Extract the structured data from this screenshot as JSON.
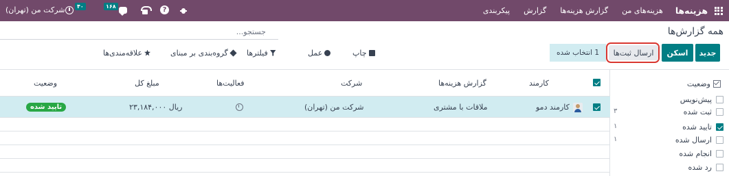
{
  "navbar": {
    "brand": "هزینه‌ها",
    "menu": [
      "هزینه‌های من",
      "گزارش هزینه‌ها",
      "گزارش",
      "پیکربندی"
    ],
    "company": "شرکت من (تهران)",
    "activities_badge": "۴۰",
    "messages_badge": "۱۶۸",
    "help": "?"
  },
  "control_panel": {
    "title": "همه گزارش‌ها",
    "search_placeholder": "جستجو...",
    "new_label": "جدید",
    "scan_label": "اسکن",
    "submit_label": "ارسال ثبت‌ها",
    "selected_label": "1 انتخاب شده",
    "print_label": "چاپ",
    "action_label": "عمل",
    "filters_label": "فیلترها",
    "group_by_label": "گروه‌بندی بر مبنای",
    "favorites_label": "علاقه‌مندی‌ها"
  },
  "list": {
    "columns": {
      "employee": "کارمند",
      "report": "گزارش هزینه‌ها",
      "company": "شرکت",
      "activities": "فعالیت‌ها",
      "total": "مبلغ کل",
      "status": "وضعیت"
    },
    "rows": [
      {
        "employee": "کارمند دمو",
        "report": "ملاقات با مشتری",
        "company": "شرکت من (تهران)",
        "total": "ریال ۲۳,۱۸۴,۰۰۰",
        "status": "تایید شده",
        "selected": true
      }
    ]
  },
  "search_panel": {
    "heading": "وضعیت",
    "items": [
      {
        "label": "پیش‌نویس",
        "count": "",
        "checked": false
      },
      {
        "label": "ثبت شده",
        "count": "۳",
        "checked": false
      },
      {
        "label": "تایید شده",
        "count": "۱",
        "checked": true
      },
      {
        "label": "ارسال شده",
        "count": "۱",
        "checked": false
      },
      {
        "label": "انجام شده",
        "count": "",
        "checked": false
      },
      {
        "label": "رد شده",
        "count": "",
        "checked": false
      }
    ]
  },
  "colors": {
    "navbar": "#71496a",
    "primary": "#017e84",
    "selected_row": "#d1ecf1",
    "status_approved": "#28a745",
    "highlight_ring": "#d9362f"
  }
}
